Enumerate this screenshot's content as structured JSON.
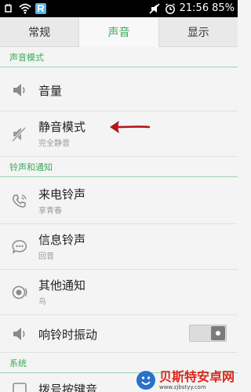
{
  "status_bar": {
    "time": "21:56",
    "battery": "85%"
  },
  "tabs": [
    {
      "label": "常规",
      "active": false
    },
    {
      "label": "声音",
      "active": true
    },
    {
      "label": "显示",
      "active": false
    }
  ],
  "sections": {
    "sound_mode": "声音模式",
    "ringtones": "铃声和通知",
    "system": "系统"
  },
  "rows": {
    "volume": {
      "title": "音量"
    },
    "silent": {
      "title": "静音模式",
      "subtitle": "完全静音"
    },
    "call_ringtone": {
      "title": "来电铃声",
      "subtitle": "享青春"
    },
    "message_ringtone": {
      "title": "信息铃声",
      "subtitle": "回音"
    },
    "other_notification": {
      "title": "其他通知",
      "subtitle": "鸟"
    },
    "vibrate_on_ring": {
      "title": "响铃时振动",
      "toggle_on": false
    },
    "touch_tone": {
      "title": "拨号按键音"
    }
  },
  "watermark": {
    "brand": "贝斯特安卓网",
    "url": "www.zjbstyy.com"
  },
  "colors": {
    "accent": "#3aaa5a",
    "annotation": "#b3141d"
  }
}
